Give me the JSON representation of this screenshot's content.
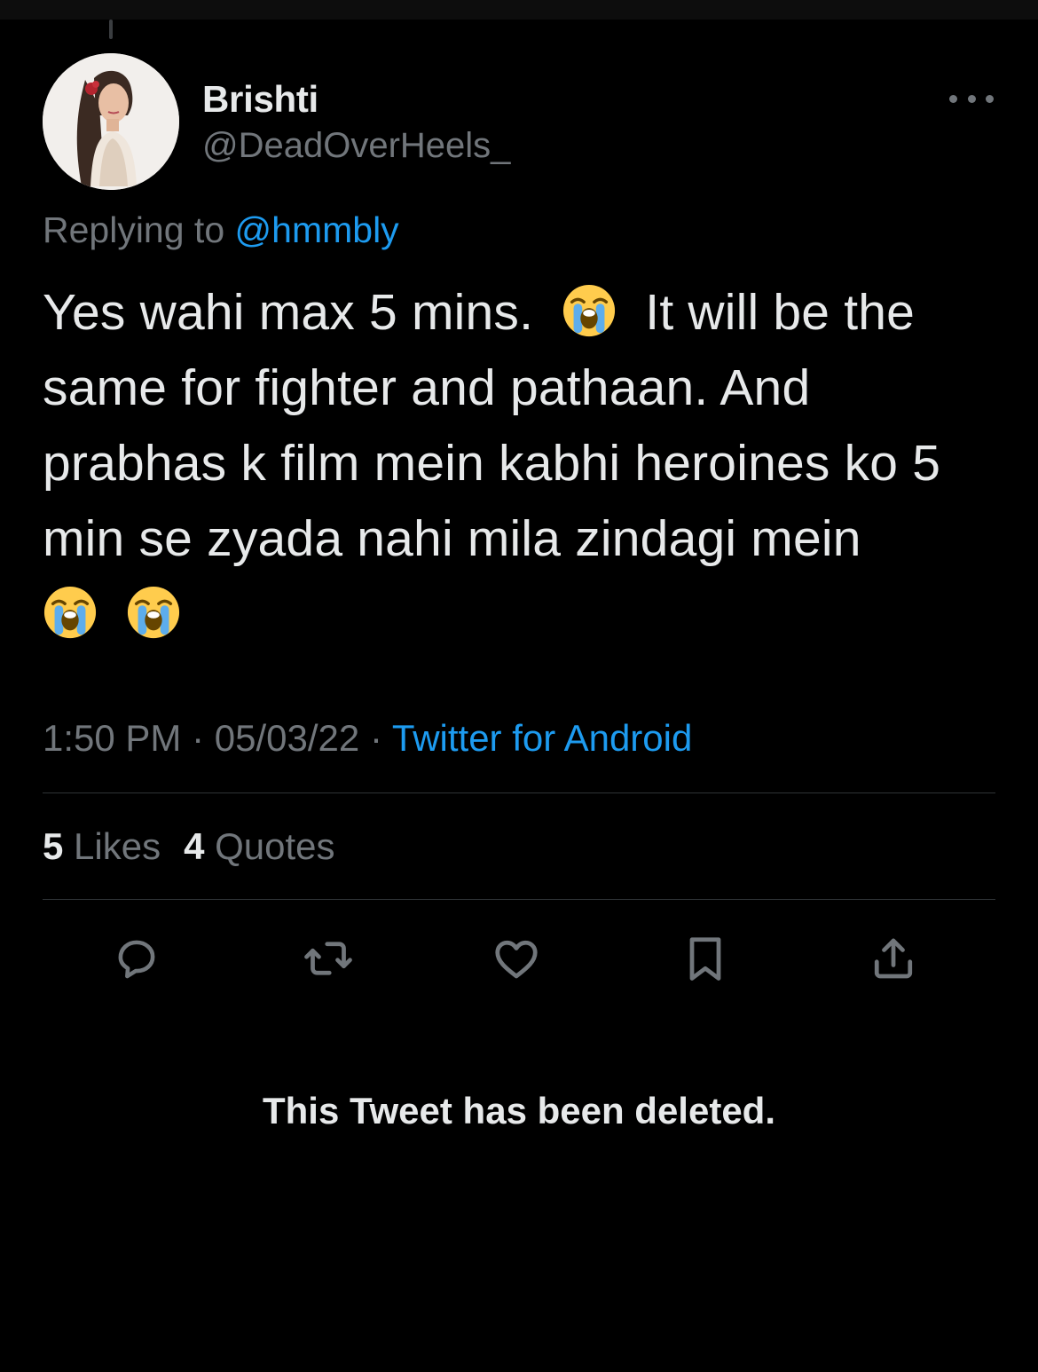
{
  "user": {
    "display_name": "Brishti",
    "handle": "@DeadOverHeels_"
  },
  "reply": {
    "prefix": "Replying to",
    "mention": "@hmmbly"
  },
  "tweet": {
    "text_1": "Yes wahi max 5 mins.",
    "text_2": "It will be the same for fighter and pathaan. And prabhas k film mein kabhi heroines ko 5 min se zyada nahi mila zindagi mein",
    "emoji_name": "loudly-crying-face"
  },
  "meta": {
    "time": "1:50 PM",
    "separator": "·",
    "date": "05/03/22",
    "source": "Twitter for Android"
  },
  "stats": {
    "likes_count": "5",
    "likes_label": "Likes",
    "quotes_count": "4",
    "quotes_label": "Quotes"
  },
  "actions": {
    "icons": [
      "reply-icon",
      "retweet-icon",
      "like-icon",
      "bookmark-icon",
      "share-icon"
    ]
  },
  "deleted_notice": "This Tweet has been deleted.",
  "colors": {
    "background": "#000000",
    "text": "#e7e9ea",
    "secondary": "#71767b",
    "link": "#1d9bf0",
    "divider": "#2f3336"
  }
}
